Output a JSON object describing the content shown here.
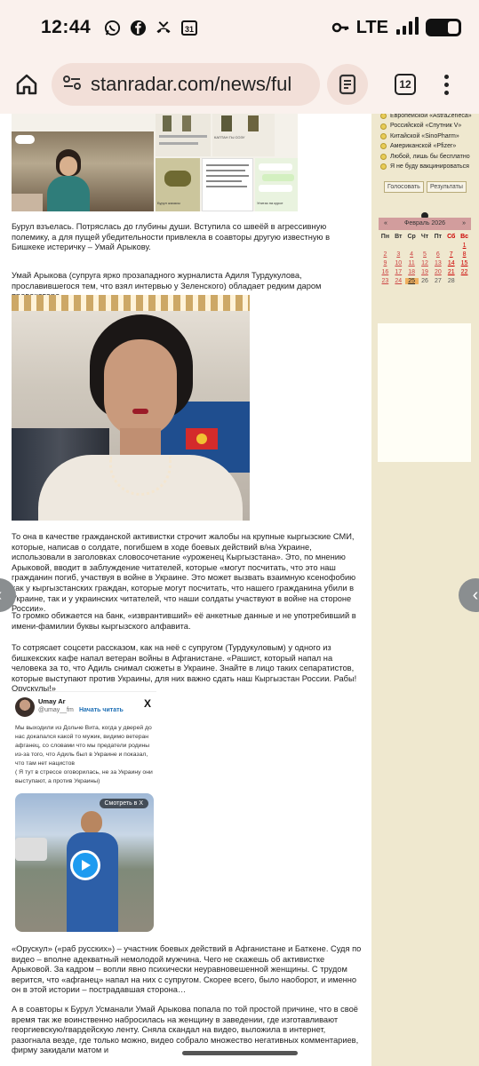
{
  "status_bar": {
    "time": "12:44",
    "network": "LTE",
    "calendar_badge": "31"
  },
  "browser": {
    "url": "stanradar.com/news/ful",
    "tab_count": "12"
  },
  "article": {
    "p1": "Бурул взъелась. Потряслась до глубины души. Вступила со швеёй в агрессивную полемику, а для пущей убедительности привлекла в соавторы другую известную в Бишкеке истеричку – Умай Арыкову.",
    "p2": "Умай Арыкова (супруга ярко прозападного журналиста Адиля Турдукулова, прославившегося тем, что взял интервью у Зеленского) обладает редким даром провокатора.",
    "p3": "То она в качестве гражданской активистки строчит жалобы на крупные кыргызские СМИ, которые, написав о солдате, погибшем в ходе боевых действий в/на Украине, использовали в заголовках словосочетание «уроженец Кыргызстана». Это, по мнению Арыковой, вводит в заблуждение читателей, которые «могут посчитать, что это наш гражданин погиб, участвуя в войне в Украине. Это может вызвать взаимную ксенофобию как у кыргызстанских граждан, которые могут посчитать, что нашего гражданина убили в Украине, так и у украинских читателей, что наши солдаты участвуют в войне на стороне России».",
    "p4": "То громко обижается на банк, «изврантивший» её анкетные данные и не употребивший в имени-фамилии буквы кыргызского алфавита.",
    "p5": "То сотрясает соцсети рассказом, как на неё с супругом (Турдукуловым) у одного из бишкекских кафе напал ветеран войны в Афганистане. «Рашист, который напал на человека за то, что Адиль снимал сюжеты в Украине. Знайте в лицо таких сепаратистов, которые выступают против Украины, для них важно сдать наш Кыргызстан России. Рабы! Орускулы!»",
    "p6": "«Орускул» («раб русских») – участник боевых действий в Афганистане и Баткене. Судя по видео – вполне адекватный немолодой мужчина. Чего не скажешь об активистке Арыковой. За кадром – вопли явно психически неуравновешенной женщины. С трудом верится, что «афганец» напал на них с супругом. Скорее всего, было наоборот, и именно он в этой истории – пострадавшая сторона…",
    "p7": "А в соавторы к Бурул Усманали Умай Арыкова попала по той простой причине, что в своё время так же воинственно набросилась на женщину в заведении, где изготавливают георгиевскую/гвардейскую ленту. Сняла скандал на видео, выложила в интернет, разогнала везде, где только можно, видео собрало множество негативных комментариев, фирму закидали матом и"
  },
  "tweet": {
    "name": "Umay Ar",
    "handle": "@umay__fm",
    "follow": "Начать читать",
    "text": "Мы выходили из Дольче Вита, когда у дверей до нас докапался какой то мужик, видимо ветеран афганец, со словами что мы предатели родины из-за того, что Адиль был в Украине и показал, что там нет нацистов\n( Я тут в стрессе оговорилась, не за Украину они выступают, а против Украины)",
    "watch_label": "Смотреть в X",
    "logo": "X"
  },
  "sidebar": {
    "poll_options": [
      "Европейской «AstraZeneca»",
      "Российской «Спутник V»",
      "Китайской «SinoPharm»",
      "Американской «Pfizer»",
      "Любой, лишь бы бесплатно",
      "Я не буду вакцинироваться"
    ],
    "vote_button": "Голосовать",
    "results_button": "Результаты",
    "calendar": {
      "prev": "«",
      "month": "Февраль 2026",
      "next": "»",
      "day_names": [
        "Пн",
        "Вт",
        "Ср",
        "Чт",
        "Пт",
        "Сб",
        "Вс"
      ],
      "weeks": [
        [
          "",
          "",
          "",
          "",
          "",
          "",
          "1"
        ],
        [
          "2",
          "3",
          "4",
          "5",
          "6",
          "7",
          "8"
        ],
        [
          "9",
          "10",
          "11",
          "12",
          "13",
          "14",
          "15"
        ],
        [
          "16",
          "17",
          "18",
          "19",
          "20",
          "21",
          "22"
        ],
        [
          "23",
          "24",
          "25",
          "26",
          "27",
          "28",
          ""
        ]
      ],
      "today": "25"
    }
  },
  "images": {
    "collage_caption_1": "Бурул жазасы",
    "collage_caption_2": "КАПТАН ГЫ СОЗУ",
    "collage_caption_3": "Унитаз на курсе",
    "collage_caption_4": "НАТУРАЛЕ"
  }
}
